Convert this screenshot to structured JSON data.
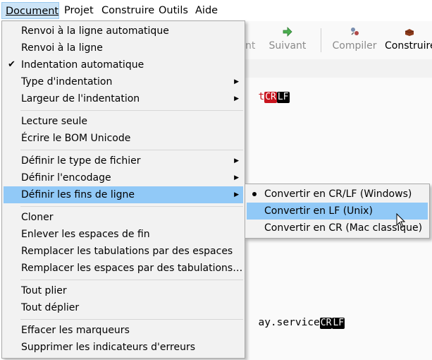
{
  "menubar": [
    {
      "label": "Document",
      "active": true
    },
    {
      "label": "Projet",
      "active": false
    },
    {
      "label": "Construire",
      "active": false
    },
    {
      "label": "Outils",
      "active": false
    },
    {
      "label": "Aide",
      "active": false
    }
  ],
  "toolbar": {
    "partial_label": "nt",
    "next_label": "Suivant",
    "compile_label": "Compiler",
    "build_label": "Construire"
  },
  "editor": {
    "line1_prefix": "t",
    "line1_eol": "CRLF",
    "line2_prefix": "ay.service",
    "line2_eol": "CRLF"
  },
  "menu": {
    "items": [
      {
        "label": "Renvoi à la ligne automatique",
        "checked": false,
        "submenu": false
      },
      {
        "label": "Renvoi à la ligne",
        "checked": false,
        "submenu": false
      },
      {
        "label": "Indentation automatique",
        "checked": true,
        "submenu": false
      },
      {
        "label": "Type d'indentation",
        "checked": false,
        "submenu": true
      },
      {
        "label": "Largeur de l'indentation",
        "checked": false,
        "submenu": true
      },
      {
        "label": "Lecture seule",
        "checked": false,
        "submenu": false
      },
      {
        "label": "Écrire le BOM Unicode",
        "checked": false,
        "submenu": false
      },
      {
        "label": "Définir le type de fichier",
        "checked": false,
        "submenu": true
      },
      {
        "label": "Définir l'encodage",
        "checked": false,
        "submenu": true
      },
      {
        "label": "Définir les fins de ligne",
        "checked": false,
        "submenu": true,
        "highlighted": true
      },
      {
        "label": "Cloner",
        "checked": false,
        "submenu": false
      },
      {
        "label": "Enlever les espaces de fin",
        "checked": false,
        "submenu": false
      },
      {
        "label": "Remplacer les tabulations par des espaces",
        "checked": false,
        "submenu": false
      },
      {
        "label": "Remplacer les espaces par des tabulations…",
        "checked": false,
        "submenu": false
      },
      {
        "label": "Tout plier",
        "checked": false,
        "submenu": false
      },
      {
        "label": "Tout déplier",
        "checked": false,
        "submenu": false
      },
      {
        "label": "Effacer les marqueurs",
        "checked": false,
        "submenu": false
      },
      {
        "label": "Supprimer les indicateurs d'erreurs",
        "checked": false,
        "submenu": false
      }
    ]
  },
  "submenu": {
    "items": [
      {
        "label": "Convertir en CR/LF (Windows)",
        "selected": true
      },
      {
        "label": "Convertir en LF (Unix)",
        "selected": false,
        "highlighted": true
      },
      {
        "label": "Convertir en CR (Mac classique)",
        "selected": false
      }
    ]
  },
  "colors": {
    "highlight": "#91c9f7",
    "menu_bg": "#f2f2f2",
    "eol_red": "#c8141e",
    "eol_black": "#000000"
  },
  "icons": [
    "arrow-right-icon",
    "compile-icon",
    "build-icon",
    "submenu-arrow-icon",
    "check-icon",
    "radio-dot-icon",
    "mouse-cursor-icon"
  ]
}
